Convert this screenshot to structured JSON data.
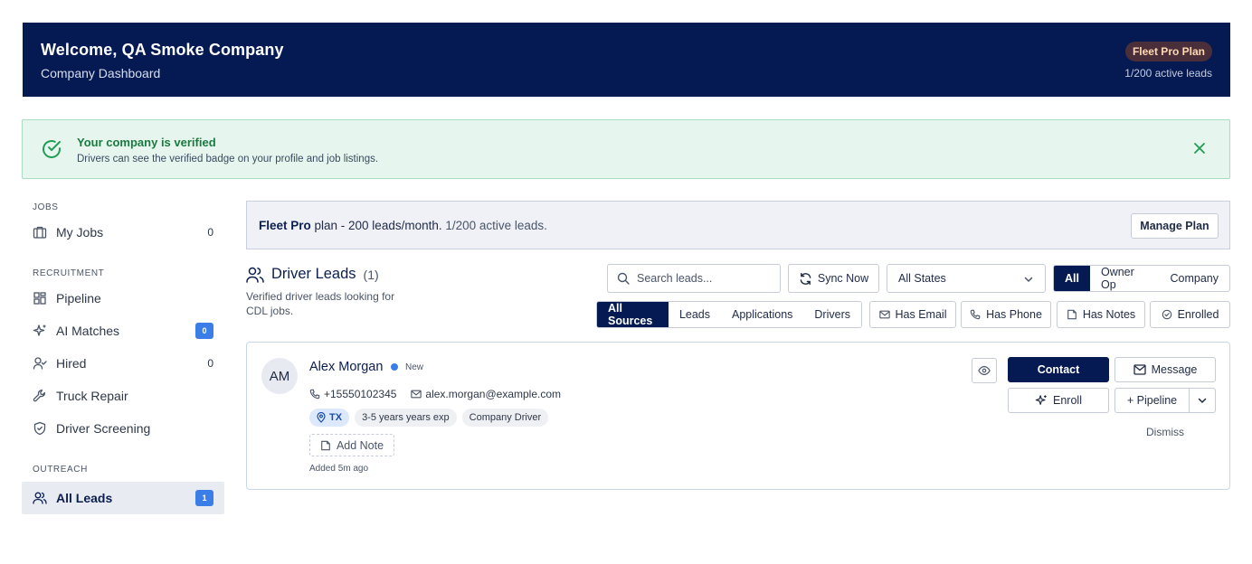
{
  "header": {
    "title": "Welcome, QA Smoke Company",
    "subtitle": "Company Dashboard",
    "plan_badge": "Fleet Pro Plan",
    "active_leads": "1/200 active leads"
  },
  "verified": {
    "title": "Your company is verified",
    "description": "Drivers can see the verified badge on your profile and job listings.",
    "color": "#1a7a3f"
  },
  "sidebar": {
    "sections": [
      {
        "label": "JOBS"
      },
      {
        "label": "RECRUITMENT"
      },
      {
        "label": "OUTREACH"
      }
    ],
    "items": [
      {
        "label": "My Jobs",
        "count": "0",
        "icon": "briefcase-icon"
      },
      {
        "label": "Pipeline",
        "icon": "pipeline-icon"
      },
      {
        "label": "AI Matches",
        "badge": "0",
        "icon": "sparkle-icon"
      },
      {
        "label": "Hired",
        "count": "0",
        "icon": "user-check-icon"
      },
      {
        "label": "Truck Repair",
        "icon": "wrench-icon"
      },
      {
        "label": "Driver Screening",
        "icon": "shield-icon"
      },
      {
        "label": "All Leads",
        "badge": "1",
        "icon": "users-icon",
        "active": true
      }
    ]
  },
  "planbar": {
    "plan_name": "Fleet Pro",
    "plan_rest": " plan - 200 leads/month.",
    "active": " 1/200 active leads.",
    "manage_label": "Manage Plan"
  },
  "leads": {
    "title": "Driver Leads",
    "count": "(1)",
    "description": "Verified driver leads looking for CDL jobs.",
    "search_placeholder": "Search leads...",
    "sync_label": "Sync Now",
    "states_selected": "All States",
    "type_options": [
      "All",
      "Owner Op",
      "Company"
    ],
    "type_selected": "All",
    "source_options": [
      "All Sources",
      "Leads",
      "Applications",
      "Drivers"
    ],
    "source_selected": "All Sources",
    "filters": [
      "Has Email",
      "Has Phone",
      "Has Notes",
      "Enrolled"
    ]
  },
  "lead_card": {
    "initials": "AM",
    "name": "Alex Morgan",
    "status": "New",
    "phone": "+15550102345",
    "email": "alex.morgan@example.com",
    "state": "TX",
    "experience": "3-5 years years exp",
    "driver_type": "Company Driver",
    "add_note_label": "Add Note",
    "added": "Added 5m ago",
    "contact_label": "Contact",
    "message_label": "Message",
    "enroll_label": "Enroll",
    "pipeline_label": "+ Pipeline",
    "dismiss_label": "Dismiss"
  },
  "colors": {
    "navy": "#051a52",
    "accent_blue": "#3b7ee8",
    "verified_bg": "#e6f6ef"
  }
}
